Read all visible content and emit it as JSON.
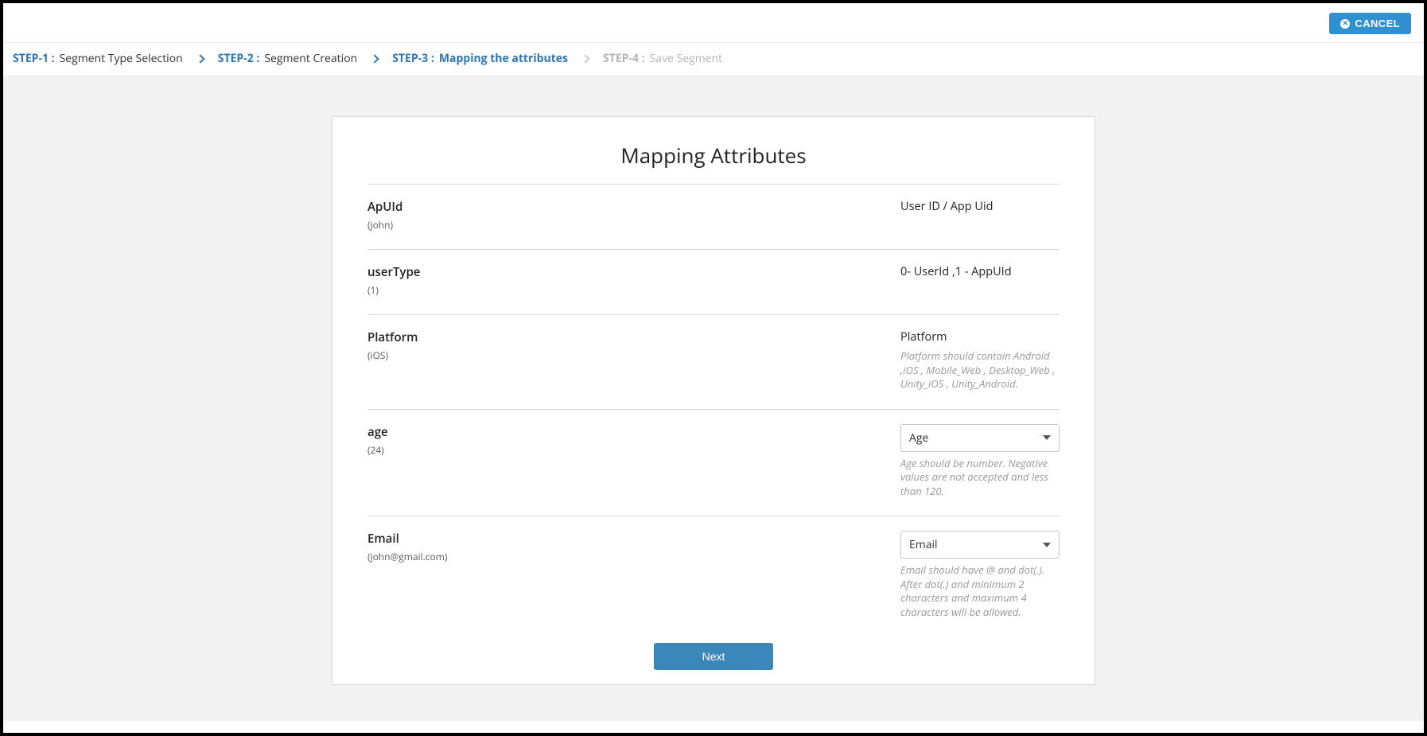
{
  "header": {
    "cancel_label": "CANCEL"
  },
  "breadcrumb": {
    "steps": [
      {
        "prefix": "STEP-1 :",
        "label": "Segment Type Selection"
      },
      {
        "prefix": "STEP-2 :",
        "label": "Segment Creation"
      },
      {
        "prefix": "STEP-3 :",
        "label": "Mapping the attributes"
      },
      {
        "prefix": "STEP-4 :",
        "label": "Save Segment"
      }
    ]
  },
  "card": {
    "title": "Mapping Attributes",
    "rows": [
      {
        "attr": "ApUId",
        "sample": "(john)",
        "map_label": "User ID / App Uid",
        "hint": ""
      },
      {
        "attr": "userType",
        "sample": "(1)",
        "map_label": "0- UserId ,1 - AppUId",
        "hint": ""
      },
      {
        "attr": "Platform",
        "sample": "(iOS)",
        "map_label": "Platform",
        "hint": "Platform should contain Android ,iOS , Mobile_Web , Desktop_Web , Unity_iOS , Unity_Android."
      },
      {
        "attr": "age",
        "sample": "(24)",
        "select": "Age",
        "hint": "Age should be number. Negative values are not accepted and less than 120."
      },
      {
        "attr": "Email",
        "sample": "(john@gmail.com)",
        "select": "Email",
        "hint": "Email should have @ and dot(.). After dot(.) and minimum 2 characters and maximum 4 characters will be allowed."
      }
    ],
    "next_label": "Next"
  }
}
